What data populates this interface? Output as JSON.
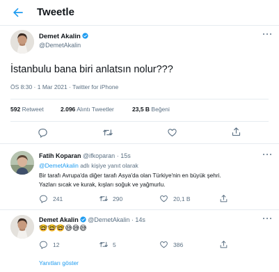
{
  "header": {
    "title": "Tweetle",
    "back_icon": "arrow-left-icon"
  },
  "main_tweet": {
    "author_name": "Demet Akalin",
    "author_handle": "@DemetAkalin",
    "text": "İstanbulu bana biri anlatsın nolur???",
    "meta": "ÖS 8:30 · 1 Mar 2021 · Twitter for iPhone",
    "stats": [
      {
        "value": "592",
        "label": "Retweet"
      },
      {
        "value": "2.096",
        "label": "Alıntı Tweetler"
      },
      {
        "value": "23,5 B",
        "label": "Beğeni"
      }
    ]
  },
  "reply1": {
    "author_name": "Fatih Koparan",
    "author_handle": "@ifkoparan",
    "time": "15s",
    "reply_to_handle": "@DemetAkalin",
    "reply_to_suffix": " adlı kişiye yanıt olarak",
    "text_lines": [
      "Bir tarafı Avrupa'da diğer tarafı Asya'da olan Türkiye'nin en büyük şehri.",
      "Yazları sıcak ve kurak, kışları soğuk ve yağmurlu."
    ],
    "reply_count": "241",
    "retweet_count": "290",
    "like_count": "20,1 B"
  },
  "reply2": {
    "author_name": "Demet Akalin",
    "author_handle": "@DemetAkalin",
    "time": "14s",
    "emojis": [
      "🤓",
      "🤓",
      "🤓",
      "😅",
      "😅",
      "😅"
    ],
    "reply_count": "12",
    "retweet_count": "5",
    "like_count": "386"
  },
  "show_replies": "Yanıtları göster",
  "colors": {
    "accent": "#1d9bf0",
    "muted": "#5b7083",
    "text": "#0f1419",
    "divider": "#e6ecf0"
  }
}
